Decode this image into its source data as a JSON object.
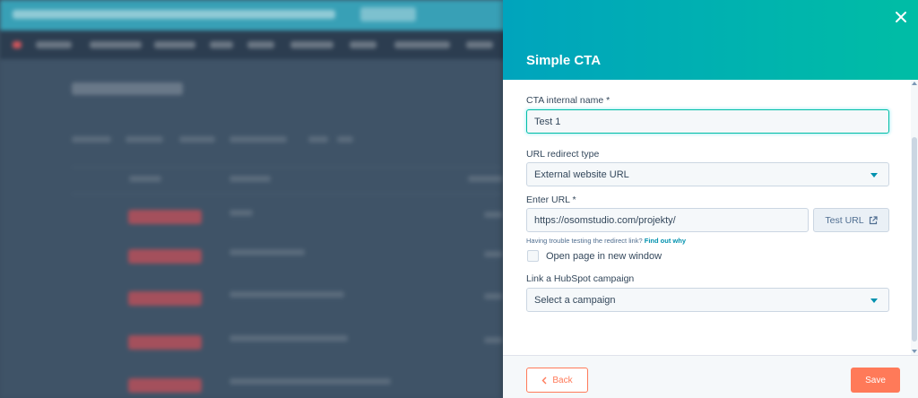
{
  "panel": {
    "title": "Simple CTA",
    "header_gradient": [
      "#00a4bd",
      "#00bda5"
    ],
    "close_icon": "close-icon"
  },
  "form": {
    "internal_name": {
      "label": "CTA internal name *",
      "value": "Test 1"
    },
    "redirect_type": {
      "label": "URL redirect type",
      "selected": "External website URL"
    },
    "url": {
      "label": "Enter URL *",
      "value": "https://osomstudio.com/projekty/",
      "test_button_label": "Test URL",
      "test_button_icon": "external-link-icon"
    },
    "helper": {
      "text": "Having trouble testing the redirect link?",
      "link": "Find out why"
    },
    "new_window": {
      "label": "Open page in new window",
      "checked": false
    },
    "campaign": {
      "label": "Link a HubSpot campaign",
      "placeholder": "Select a campaign"
    }
  },
  "footer": {
    "back_label": "Back",
    "back_icon": "chevron-left-icon",
    "save_label": "Save",
    "accent": "#ff7a59"
  }
}
